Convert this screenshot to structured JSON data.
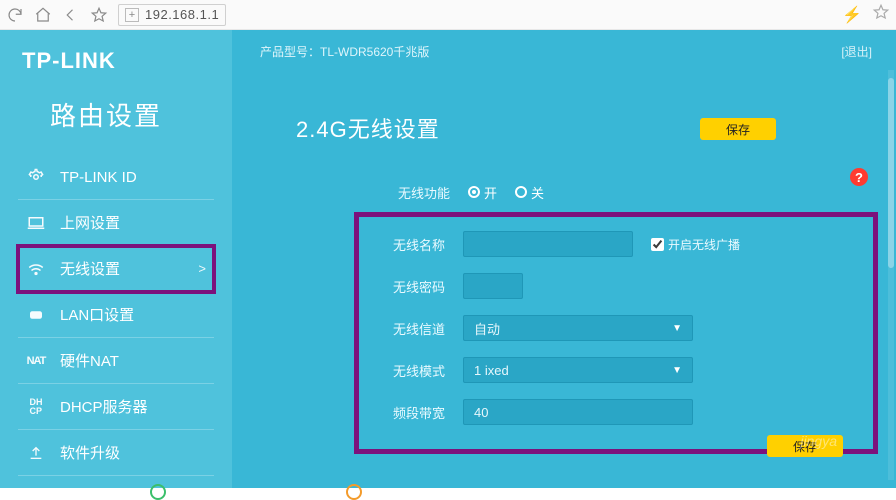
{
  "browser": {
    "url": "192.168.1.1"
  },
  "brand": "TP-LINK",
  "sidebar_title": "路由设置",
  "menu": {
    "tplink_id": "TP-LINK ID",
    "wan": "上网设置",
    "wireless": "无线设置",
    "lan": "LAN口设置",
    "nat": "硬件NAT",
    "dhcp": "DHCP服务器",
    "upgrade": "软件升级"
  },
  "topbar": {
    "model_label": "产品型号：TL-WDR5620千兆版",
    "logout": "[退出]"
  },
  "buttons": {
    "save": "保存"
  },
  "page_title": "2.4G无线设置",
  "form": {
    "wireless_func_label": "无线功能",
    "on_label": "开",
    "off_label": "关",
    "ssid_label": "无线名称",
    "ssid_value": "",
    "broadcast_label": "开启无线广播",
    "pwd_label": "无线密码",
    "pwd_value": "",
    "channel_label": "无线信道",
    "channel_value": "自动",
    "mode_label": "无线模式",
    "mode_value": "1          ixed",
    "bandwidth_label": "频段带宽",
    "bandwidth_value": "40"
  },
  "watermark": "jingya"
}
